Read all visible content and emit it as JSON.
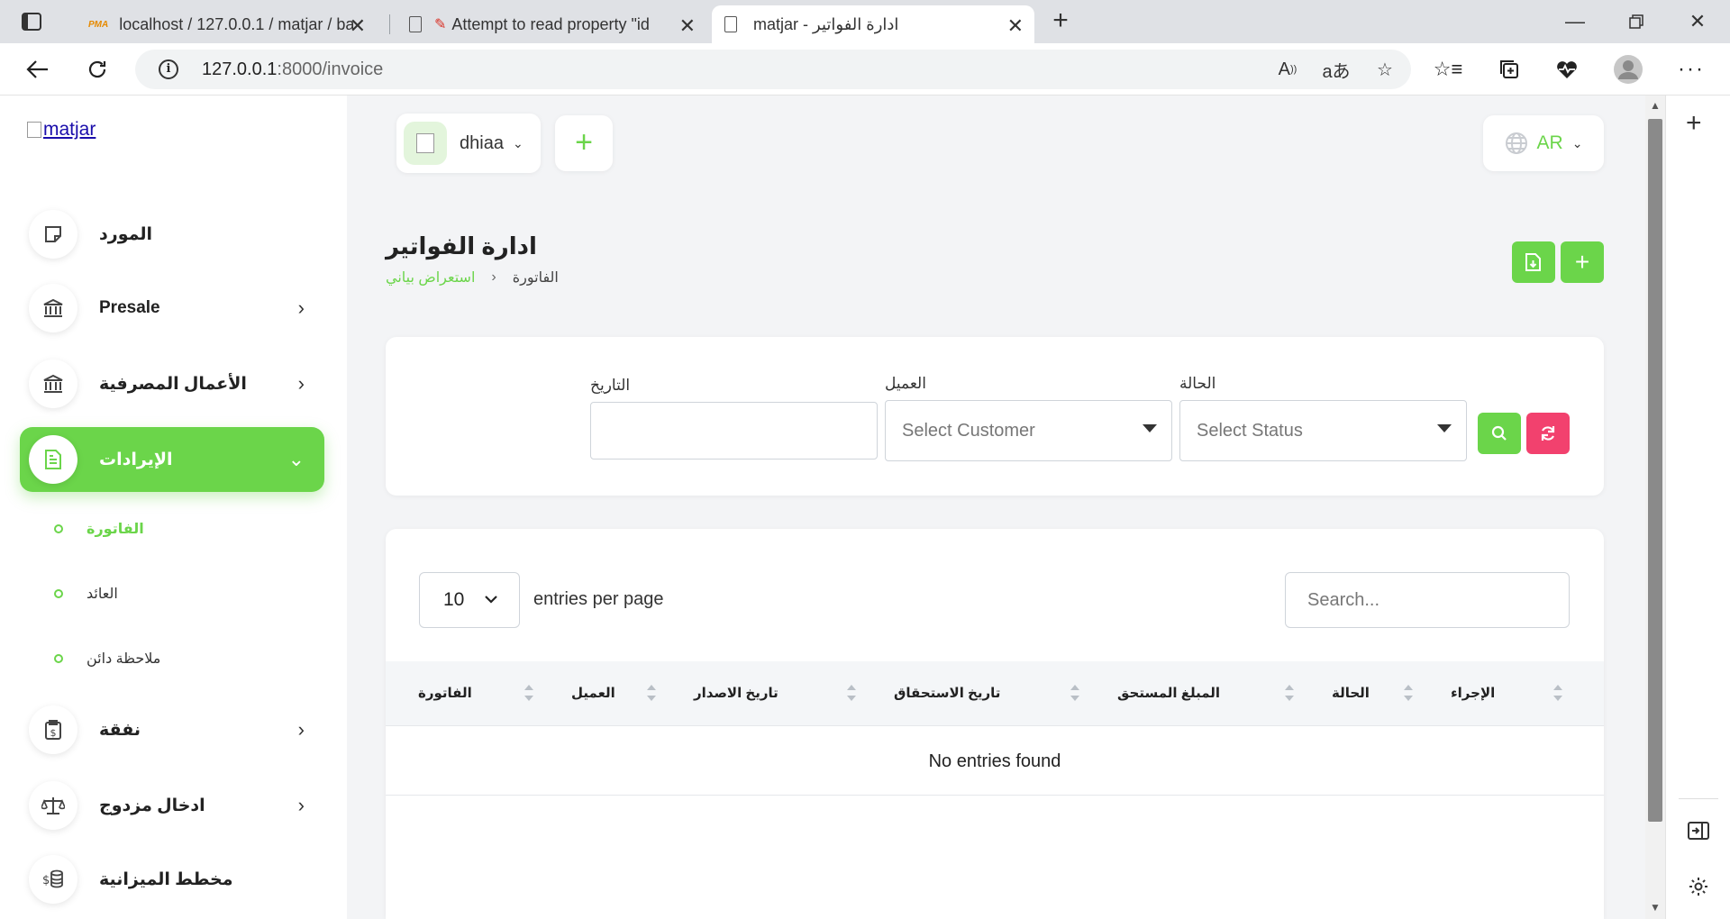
{
  "browser": {
    "tabs": [
      {
        "title": "localhost / 127.0.0.1 / matjar / ba",
        "favicon": "pma-icon"
      },
      {
        "title": "Attempt to read property \"id",
        "favicon": "page-icon"
      },
      {
        "title": "matjar - ادارة الفواتير",
        "favicon": "page-icon"
      }
    ],
    "url_host": "127.0.0.1",
    "url_rest": ":8000/invoice"
  },
  "header": {
    "user_name": "dhiaa",
    "language": "AR"
  },
  "sidebar": {
    "logo_alt": "matjar",
    "items": [
      {
        "label": "المورد",
        "icon": "note-icon",
        "has_chevron": false
      },
      {
        "label": "Presale",
        "icon": "bank-icon",
        "has_chevron": true
      },
      {
        "label": "الأعمال المصرفية",
        "icon": "bank-icon",
        "has_chevron": true
      },
      {
        "label": "الإيرادات",
        "icon": "document-icon",
        "has_chevron": true,
        "active": true
      },
      {
        "label": "نفقة",
        "icon": "receipt-icon",
        "has_chevron": true
      },
      {
        "label": "ادخال مزدوج",
        "icon": "scale-icon",
        "has_chevron": true
      },
      {
        "label": "مخطط الميزانية",
        "icon": "coins-icon",
        "has_chevron": false
      }
    ],
    "sub_items": [
      {
        "label": "الفاتورة",
        "active": true
      },
      {
        "label": "العائد"
      },
      {
        "label": "ملاحظة دائن"
      }
    ]
  },
  "page": {
    "title": "ادارة الفواتير",
    "breadcrumb": [
      "استعراض بياني",
      "الفاتورة"
    ]
  },
  "filters": {
    "date_label": "التاريخ",
    "customer_label": "العميل",
    "customer_placeholder": "Select Customer",
    "status_label": "الحالة",
    "status_placeholder": "Select Status"
  },
  "table": {
    "entries_value": "10",
    "entries_label": "entries per page",
    "search_placeholder": "Search...",
    "columns": [
      "الفاتورة",
      "العميل",
      "تاريخ الاصدار",
      "تاريخ الاستحقاق",
      "المبلغ المستحق",
      "الحالة",
      "الإجراء"
    ],
    "empty_text": "No entries found"
  },
  "colors": {
    "accent": "#6bd54a",
    "danger": "#f2416e"
  }
}
